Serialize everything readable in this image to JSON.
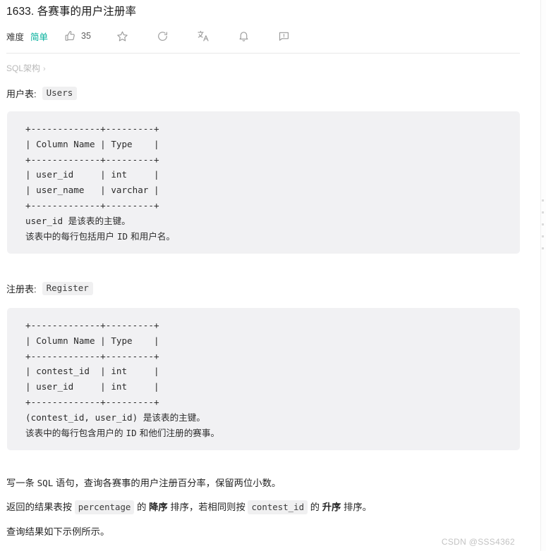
{
  "problem": {
    "title": "1633. 各赛事的用户注册率",
    "difficulty_label": "难度",
    "difficulty_value": "简单",
    "difficulty_color": "#00af9b",
    "like_count": "35"
  },
  "toolbar": {
    "like_icon": "thumbs-up-icon",
    "favorite_icon": "star-icon",
    "share_icon": "share-refresh-icon",
    "translate_icon": "translate-icon",
    "notify_icon": "bell-icon",
    "feedback_icon": "speech-bubble-alert-icon"
  },
  "breadcrumb": {
    "label": "SQL架构",
    "chevron": "›"
  },
  "tables": [
    {
      "caption": "用户表:",
      "name": "Users",
      "ascii": "+-------------+---------+\n| Column Name | Type    |\n+-------------+---------+\n| user_id     | int     |\n| user_name   | varchar |\n+-------------+---------+",
      "notes_mono": "user_id ",
      "note1_cn": "是该表的主键。",
      "note2_prefix_cn": "该表中的每行包括用户 ",
      "note2_mono": "ID",
      "note2_suffix_cn": " 和用户名。"
    },
    {
      "caption": "注册表:",
      "name": "Register",
      "ascii": "+-------------+---------+\n| Column Name | Type    |\n+-------------+---------+\n| contest_id  | int     |\n| user_id     | int     |\n+-------------+---------+",
      "notes_mono": "(contest_id, user_id) ",
      "note1_cn": "是该表的主键。",
      "note2_prefix_cn": "该表中的每行包含用户的 ",
      "note2_mono": "ID",
      "note2_suffix_cn": " 和他们注册的赛事。"
    }
  ],
  "description": {
    "line1_a": "写一条 ",
    "line1_sql": "SQL",
    "line1_b": " 语句，查询各赛事的用户注册百分率，保留两位小数。",
    "line2_a": "返回的结果表按 ",
    "line2_chip1": "percentage",
    "line2_b": " 的 ",
    "line2_bold1": "降序",
    "line2_c": " 排序，若相同则按 ",
    "line2_chip2": "contest_id",
    "line2_d": " 的 ",
    "line2_bold2": "升序",
    "line2_e": " 排序。",
    "line3": "查询结果如下示例所示。"
  },
  "watermark": "CSDN @SSS4362"
}
